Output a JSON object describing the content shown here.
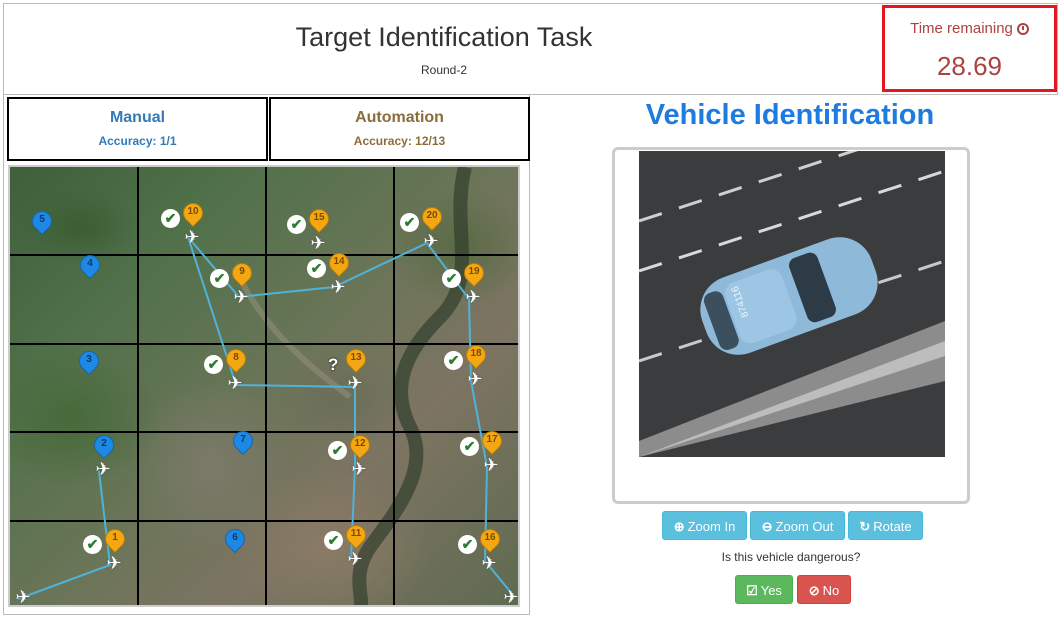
{
  "header": {
    "title": "Target Identification Task",
    "round": "Round-2",
    "timer_label": "Time remaining",
    "timer_value": "28.69",
    "timer_icon": "clock-icon"
  },
  "tabs": {
    "manual": {
      "title": "Manual",
      "accuracy": "Accuracy: 1/1",
      "color": "#337ab7"
    },
    "automation": {
      "title": "Automation",
      "accuracy": "Accuracy: 12/13",
      "color": "#8a6d3b"
    }
  },
  "map": {
    "pins": [
      {
        "num": "1",
        "color": "orange"
      },
      {
        "num": "2",
        "color": "blue"
      },
      {
        "num": "3",
        "color": "blue"
      },
      {
        "num": "4",
        "color": "blue"
      },
      {
        "num": "5",
        "color": "blue"
      },
      {
        "num": "6",
        "color": "blue"
      },
      {
        "num": "7",
        "color": "blue"
      },
      {
        "num": "8",
        "color": "orange"
      },
      {
        "num": "9",
        "color": "orange"
      },
      {
        "num": "10",
        "color": "orange"
      },
      {
        "num": "11",
        "color": "orange"
      },
      {
        "num": "12",
        "color": "orange"
      },
      {
        "num": "13",
        "color": "orange"
      },
      {
        "num": "14",
        "color": "orange"
      },
      {
        "num": "15",
        "color": "orange"
      },
      {
        "num": "16",
        "color": "orange"
      },
      {
        "num": "17",
        "color": "orange"
      },
      {
        "num": "18",
        "color": "orange"
      },
      {
        "num": "19",
        "color": "orange"
      },
      {
        "num": "20",
        "color": "orange"
      }
    ],
    "checked_targets": [
      "1",
      "8",
      "9",
      "10",
      "11",
      "12",
      "14",
      "15",
      "16",
      "17",
      "18",
      "19",
      "20"
    ],
    "unknown_marker": "?",
    "colors": {
      "automation_pin": "#f3a712",
      "manual_pin": "#1e88e5",
      "route": "#4fb3d9"
    }
  },
  "identification": {
    "title": "Vehicle Identification",
    "image_alt": "aerial view of light blue car on road",
    "vehicle_text": "874116",
    "buttons": {
      "zoom_in": "Zoom In",
      "zoom_out": "Zoom Out",
      "rotate": "Rotate"
    },
    "question": "Is this vehicle dangerous?",
    "yes": "Yes",
    "no": "No"
  }
}
